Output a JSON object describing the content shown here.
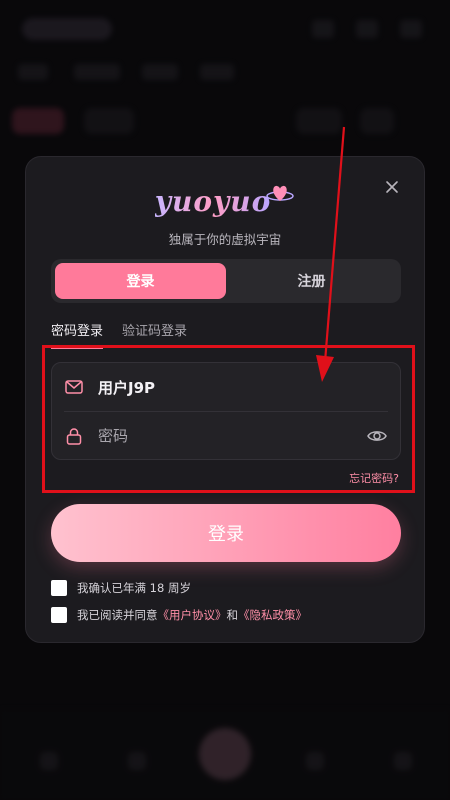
{
  "brand": {
    "logo_text": "yuoyuo",
    "tagline": "独属于你的虚拟宇宙"
  },
  "tabs": [
    {
      "label": "登录",
      "active": true
    },
    {
      "label": "注册",
      "active": false
    }
  ],
  "subtabs": [
    {
      "label": "密码登录",
      "active": true
    },
    {
      "label": "验证码登录",
      "active": false
    }
  ],
  "form": {
    "username_value": "用户J9P",
    "password_placeholder": "密码",
    "forgot_label": "忘记密码?",
    "submit_label": "登录"
  },
  "agreements": {
    "age_label": "我确认已年满 18 周岁",
    "terms_prefix": "我已阅读并同意",
    "user_agreement": "《用户协议》",
    "and": "和",
    "privacy_policy": "《隐私政策》"
  },
  "colors": {
    "accent": "#ff7a9a",
    "annotation": "#e0101a",
    "modal_bg": "#1c1b1f"
  },
  "icons": {
    "close": "close-icon",
    "username": "mail-icon",
    "password": "lock-icon",
    "visibility": "eye-icon"
  }
}
